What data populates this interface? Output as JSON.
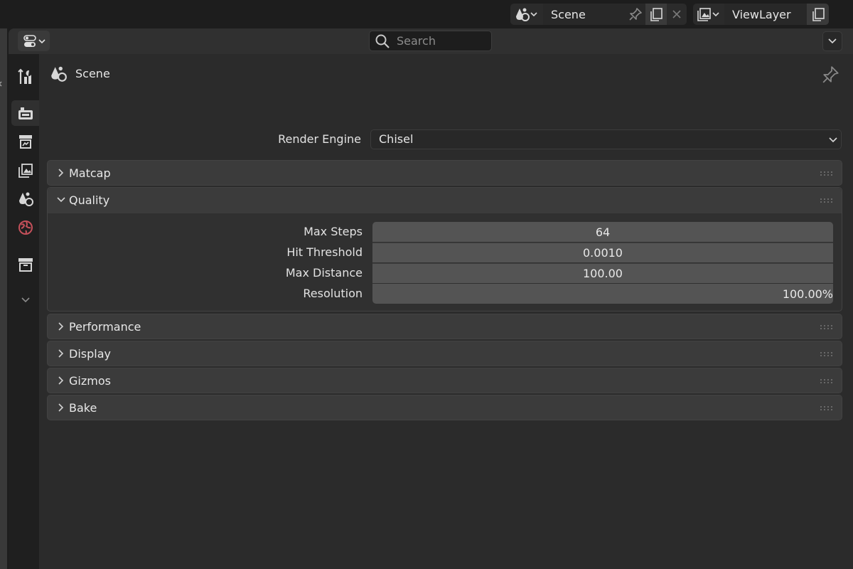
{
  "header": {
    "scene_name": "Scene",
    "view_layer_name": "ViewLayer"
  },
  "search": {
    "placeholder": "Search"
  },
  "context": {
    "title": "Scene"
  },
  "render_engine": {
    "label": "Render Engine",
    "value": "Chisel"
  },
  "panels": {
    "matcap": {
      "title": "Matcap",
      "expanded": false
    },
    "quality": {
      "title": "Quality",
      "expanded": true
    },
    "performance": {
      "title": "Performance",
      "expanded": false
    },
    "display": {
      "title": "Display",
      "expanded": false
    },
    "gizmos": {
      "title": "Gizmos",
      "expanded": false
    },
    "bake": {
      "title": "Bake",
      "expanded": false
    }
  },
  "quality": {
    "max_steps": {
      "label": "Max Steps",
      "value": "64"
    },
    "hit_threshold": {
      "label": "Hit Threshold",
      "value": "0.0010"
    },
    "max_distance": {
      "label": "Max Distance",
      "value": "100.00"
    },
    "resolution": {
      "label": "Resolution",
      "value": "100.00%",
      "fraction": 1.0
    }
  },
  "colors": {
    "accent": "#4672c4",
    "world_icon": "#c4505a"
  },
  "tabs": [
    {
      "name": "tool",
      "active": false
    },
    {
      "name": "render",
      "active": true
    },
    {
      "name": "output",
      "active": false
    },
    {
      "name": "view-layer",
      "active": false
    },
    {
      "name": "scene",
      "active": false
    },
    {
      "name": "world",
      "active": false
    },
    {
      "name": "collection",
      "active": false
    }
  ]
}
